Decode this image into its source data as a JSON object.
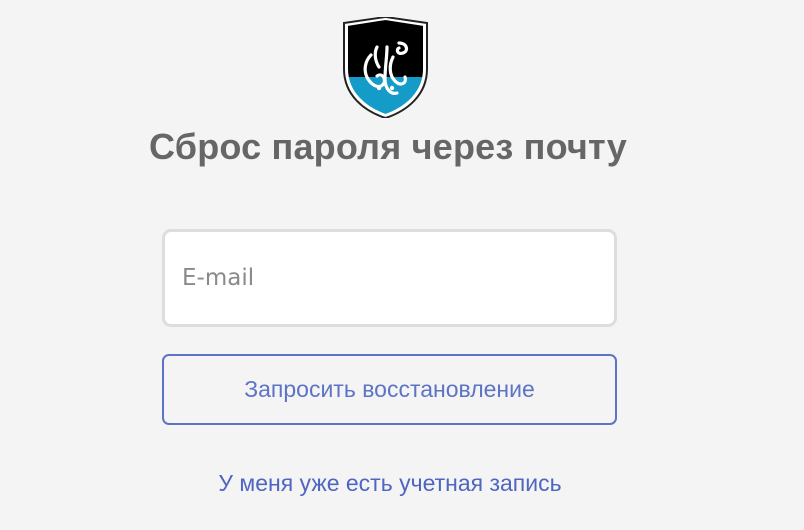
{
  "brand": {
    "logo_icon": "octopus-shield-logo",
    "colors": {
      "shield_black": "#000000",
      "shield_blue": "#149bc7",
      "shield_border": "#222222"
    }
  },
  "page": {
    "title": "Сброс пароля через почту",
    "background": "#f4f4f4"
  },
  "form": {
    "email_placeholder": "E-mail",
    "email_value": "",
    "submit_label": "Запросить восстановление"
  },
  "footer": {
    "login_link_label": "У меня уже есть учетная запись"
  },
  "colors": {
    "accent": "#5d74c6",
    "title": "#666666"
  }
}
